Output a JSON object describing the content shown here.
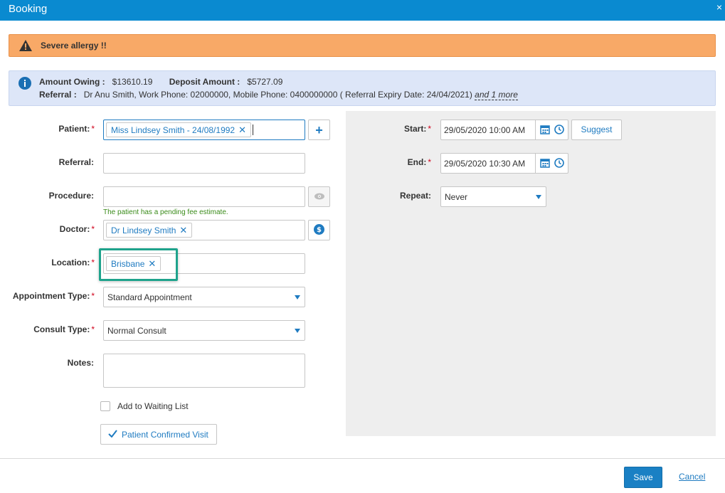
{
  "dialog": {
    "title": "Booking",
    "close_glyph": "×"
  },
  "alert": {
    "text": "Severe allergy !!",
    "icon": "warning-icon"
  },
  "info": {
    "amount_owing_label": "Amount Owing :",
    "amount_owing_value": "$13610.19",
    "deposit_label": "Deposit Amount :",
    "deposit_value": "$5727.09",
    "referral_label": "Referral :",
    "referral_value": "Dr Anu Smith, Work Phone: 02000000, Mobile Phone: 0400000000 ( Referral Expiry Date: 24/04/2021)",
    "more_link": "and 1 more"
  },
  "form": {
    "patient": {
      "label": "Patient:",
      "tag": "Miss Lindsey Smith - 24/08/1992"
    },
    "referral": {
      "label": "Referral:",
      "value": ""
    },
    "procedure": {
      "label": "Procedure:",
      "value": "",
      "hint": "The patient has a pending fee estimate."
    },
    "doctor": {
      "label": "Doctor:",
      "tag": "Dr Lindsey Smith"
    },
    "location": {
      "label": "Location:",
      "tag": "Brisbane"
    },
    "appointment_type": {
      "label": "Appointment Type:",
      "value": "Standard Appointment"
    },
    "consult_type": {
      "label": "Consult Type:",
      "value": "Normal Consult"
    },
    "notes": {
      "label": "Notes:",
      "value": ""
    },
    "waiting_list": {
      "label": "Add to Waiting List",
      "checked": false
    },
    "confirm_button": "Patient Confirmed Visit",
    "required_mark": "*",
    "tag_remove_glyph": "✕",
    "add_glyph": "+"
  },
  "schedule": {
    "start": {
      "label": "Start:",
      "value": "29/05/2020 10:00 AM"
    },
    "end": {
      "label": "End:",
      "value": "29/05/2020 10:30 AM"
    },
    "repeat": {
      "label": "Repeat:",
      "value": "Never"
    },
    "suggest_button": "Suggest"
  },
  "footer": {
    "save": "Save",
    "cancel": "Cancel"
  },
  "colors": {
    "titlebar": "#0a8ad0",
    "alert": "#f8a967",
    "info": "#dde6f8",
    "accent": "#1f7bc1",
    "highlight": "#1ea38c",
    "hint": "#3a8b1a",
    "required": "#d0021b"
  }
}
